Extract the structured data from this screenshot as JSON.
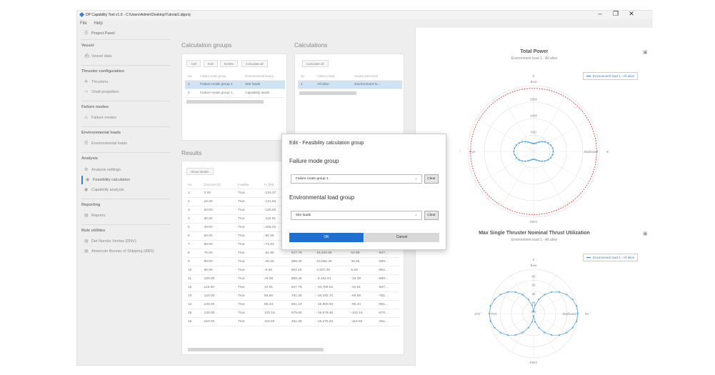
{
  "window": {
    "title": "DP Capability Tool v1.0 - C:\\Users\\Admin\\Desktop\\Tutorial1.dpproj",
    "minimize": "–",
    "maximize": "❐",
    "close": "✕"
  },
  "menu": [
    "File",
    "Help"
  ],
  "sidebar": {
    "project_panel": "Project Panel",
    "sections": [
      {
        "heading": "Vessel",
        "items": [
          "Vessel data"
        ]
      },
      {
        "heading": "Thruster configuration",
        "items": [
          "Thrusters",
          "Shaft propellers"
        ]
      },
      {
        "heading": "Failure modes",
        "items": [
          "Failure modes"
        ]
      },
      {
        "heading": "Environmental loads",
        "items": [
          "Environmental loads"
        ]
      },
      {
        "heading": "Analysis",
        "items": [
          "Analysis settings",
          "Feasibility calculation",
          "Capability analysis"
        ]
      },
      {
        "heading": "Reporting",
        "items": [
          "Reports"
        ]
      },
      {
        "heading": "Rule utilities",
        "items": [
          "Det Norske Veritas (DNV)",
          "American Bureau of Shipping (ABS)"
        ]
      }
    ],
    "active": "Feasibility calculation"
  },
  "calc_groups": {
    "title": "Calculation groups",
    "buttons": [
      "Add",
      "Edit",
      "Delete",
      "Calculate all"
    ],
    "columns": [
      "No.",
      "Failure mode group",
      "Environmental load g..."
    ],
    "rows": [
      [
        "1",
        "Failure mode group 1",
        "Site loads"
      ],
      [
        "2",
        "Failure mode group 1",
        "Capability loads"
      ]
    ]
  },
  "calculations": {
    "title": "Calculations",
    "button": "Calculate all",
    "columns": [
      "No.",
      "Failure mode",
      "Environment load"
    ],
    "rows": [
      [
        "1",
        "All alive",
        "Environment lo..."
      ]
    ]
  },
  "results": {
    "title": "Results",
    "button": "Show details",
    "columns": [
      "No.",
      "Direction [d]",
      "Feasible",
      "Fx [kN]",
      "Fy [kN]",
      "Mz [kNm]",
      "Power",
      "Total..."
    ],
    "rows": [
      [
        "1",
        "0.00",
        "True",
        "-134.27",
        "",
        "",
        "",
        ""
      ],
      [
        "2",
        "10.00",
        "True",
        "-131.62",
        "",
        "",
        "",
        ""
      ],
      [
        "3",
        "20.00",
        "True",
        "-125.82",
        "",
        "",
        "",
        ""
      ],
      [
        "4",
        "30.00",
        "True",
        "-116.91",
        "",
        "",
        "",
        ""
      ],
      [
        "5",
        "40.00",
        "True",
        "-105.01",
        "",
        "",
        "",
        ""
      ],
      [
        "6",
        "50.00",
        "True",
        "-90.26",
        "",
        "",
        "",
        ""
      ],
      [
        "7",
        "60.00",
        "True",
        "-72.83",
        "781.30",
        "21,397.65",
        "72.83",
        "-781..."
      ],
      [
        "8",
        "70.00",
        "True",
        "-52.88",
        "847.76",
        "16,420.55",
        "52.88",
        "-847..."
      ],
      [
        "9",
        "80.00",
        "True",
        "-30.65",
        "889.46",
        "10,085.30",
        "30.65",
        "-889..."
      ],
      [
        "10",
        "90.00",
        "True",
        "-6.59",
        "902.16",
        "2,507.39",
        "6.59",
        "-902..."
      ],
      [
        "11",
        "100.00",
        "True",
        "18.39",
        "889.46",
        "-4,161.91",
        "-18.39",
        "-889..."
      ],
      [
        "12",
        "110.00",
        "True",
        "42.91",
        "847.76",
        "-10,768.51",
        "-42.91",
        "-847..."
      ],
      [
        "13",
        "120.00",
        "True",
        "65.56",
        "781.30",
        "-16,183.70",
        "-65.56",
        "-781..."
      ],
      [
        "14",
        "130.00",
        "True",
        "85.44",
        "691.10",
        "-19,860.93",
        "-85.44",
        "-691..."
      ],
      [
        "15",
        "140.00",
        "True",
        "102.16",
        "579.90",
        "-19,678.46",
        "-102.16",
        "-579..."
      ],
      [
        "16",
        "150.00",
        "True",
        "115.50",
        "451.30",
        "-16,275.04",
        "-115.50",
        "-451..."
      ]
    ]
  },
  "dialog": {
    "title": "Edit - Feasibility calculation group",
    "failure_label": "Failure mode group",
    "failure_value": "Failure mode group 1",
    "env_label": "Environmental load group",
    "env_value": "Site loads",
    "clear": "Clear",
    "ok": "OK",
    "cancel": "Cancel"
  },
  "chart1": {
    "title": "Total Power",
    "subtitle": "Environment load 1 - All alive",
    "legend": "Environment load 1 - All alive",
    "rings": [
      "1500",
      "1000",
      "500"
    ],
    "angle_labels": {
      "top": "0",
      "bottom": "180 °",
      "left": "270 °",
      "right": "90 °",
      "bow": "Bow",
      "stern": "Stern",
      "port": "Port",
      "starboard": "Starboard"
    }
  },
  "chart2": {
    "title": "Max Single Thruster Nominal Thrust Utilization",
    "subtitle": "Environment load 1 - All alive",
    "legend": "Environment load 1 - All alive",
    "rings": [
      "80",
      "60",
      "40",
      "20",
      "0%"
    ],
    "angle_labels": {
      "top": "0",
      "bottom": "180 °",
      "left": "270 °",
      "right": "90 °",
      "bow": "Bow",
      "stern": "Stern",
      "port": "Port",
      "starboard": "Starboard"
    }
  },
  "colors": {
    "accent": "#1e6fd0",
    "series": "#5aa9e6",
    "limit": "#e03030"
  },
  "icons": {
    "save": "save-icon"
  }
}
